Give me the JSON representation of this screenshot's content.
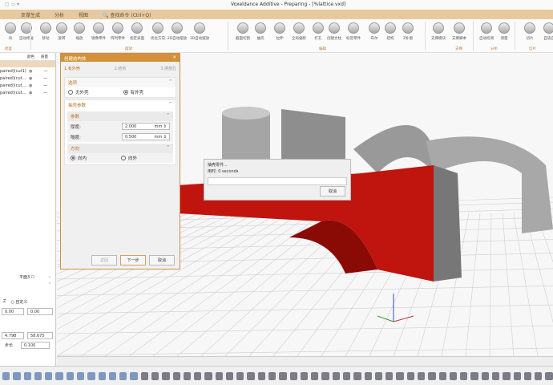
{
  "window": {
    "title": "Voxeldance Additive - Preparing - [%lattice.vxd]"
  },
  "menu": {
    "items": [
      "支撑生成",
      "分析",
      "视图"
    ],
    "search": "查找命令 (Ctrl+Q)"
  },
  "ribbon": {
    "buttons": [
      "块",
      "自动修复",
      "移动",
      "旋转",
      "缩放",
      "镜像零件",
      "阵列零件",
      "指定表面",
      "优化方向",
      "2D自动摆放",
      "3D自动摆放",
      "截面切割",
      "抽壳",
      "拉伸",
      "全局偏移",
      "打孔",
      "创建文柱",
      "标签零件",
      "布尔",
      "结构",
      "Z补偿",
      "支撑模块",
      "支撑脚本",
      "自动检测",
      "测量",
      "切片",
      "自适应"
    ],
    "groups": [
      "修复",
      "摆放",
      "编辑",
      "支撑",
      "分析",
      "切片"
    ]
  },
  "left_panel": {
    "columns": [
      "颜色",
      "质量"
    ],
    "rows": [
      "paired)(cut1)",
      "paired)(cut...",
      "paired)(cut...",
      "paired)(cut..."
    ],
    "plane_label": "平面3",
    "custom_label": "自定义",
    "z_label": "Z",
    "values": [
      "0.00",
      "0.00",
      "4.798",
      "58.675"
    ],
    "step_label": "步长",
    "step": "0.100"
  },
  "dialog": {
    "title": "创建结构体",
    "steps": [
      "1.有外壳",
      "2.结构",
      "3.排放孔"
    ],
    "options": {
      "title": "选项",
      "no_shell": "无外壳",
      "shell": "有外壳",
      "selected": "有外壳"
    },
    "shell_params": {
      "title": "抽壳参数",
      "params_title": "参数",
      "thickness_label": "厚度:",
      "thickness": "2.000",
      "thickness_unit": "mm",
      "gap_label": "隔度:",
      "gap": "0.500",
      "gap_unit": "mm"
    },
    "direction": {
      "title": "方向",
      "inward": "向内",
      "outward": "向外",
      "selected": "向内"
    },
    "buttons": {
      "back": "返回",
      "next": "下一步",
      "cancel": "取消"
    }
  },
  "progress": {
    "title": "抽壳零件...",
    "elapsed": "用时: 0 seconds",
    "cancel": "取消",
    "value": 0
  },
  "colors": {
    "accent": "#d4913a",
    "model_red": "#c0140e",
    "menu": "#e7c9a0"
  }
}
